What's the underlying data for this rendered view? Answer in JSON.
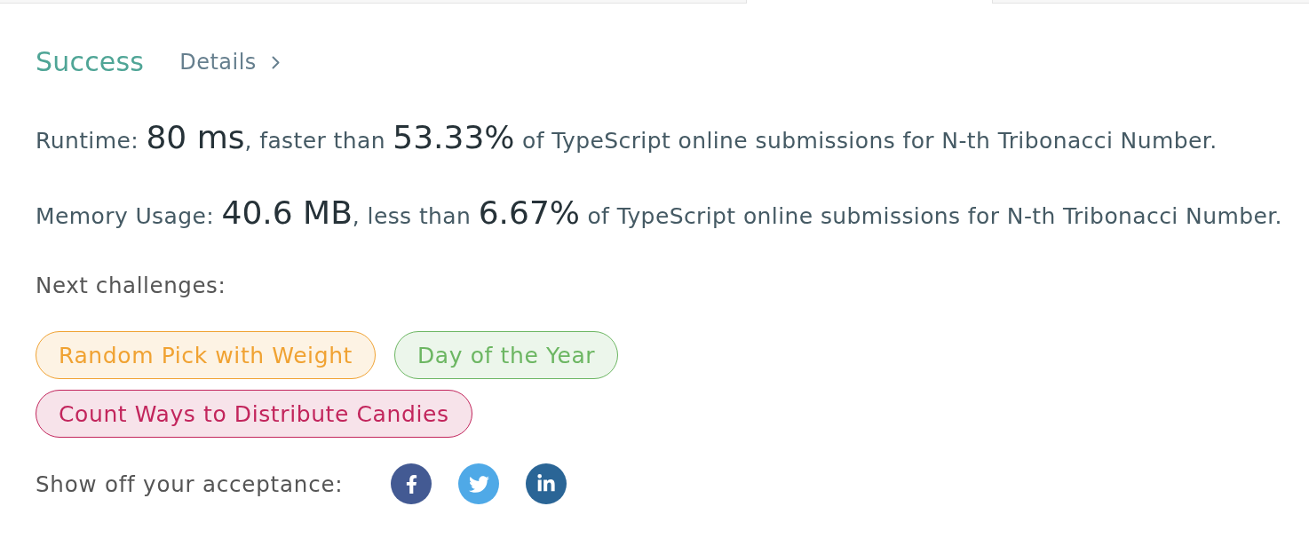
{
  "result": {
    "status": "Success",
    "details_link": "Details"
  },
  "stats": [
    {
      "label": "Runtime:",
      "value": "80 ms",
      "comparison": ", faster than",
      "percent": "53.33%",
      "suffix": "of TypeScript online submissions for N-th Tribonacci Number."
    },
    {
      "label": "Memory Usage:",
      "value": "40.6 MB",
      "comparison": ", less than",
      "percent": "6.67%",
      "suffix": "of TypeScript online submissions for N-th Tribonacci Number."
    }
  ],
  "next_challenges": {
    "label": "Next challenges:",
    "items": [
      {
        "title": "Random Pick with Weight",
        "color": "#f0a232"
      },
      {
        "title": "Day of the Year",
        "color": "#6cb662"
      },
      {
        "title": "Count Ways to Distribute Candies",
        "color": "#c2255c"
      }
    ]
  },
  "share": {
    "label": "Show off your acceptance:",
    "networks": [
      {
        "kind": "facebook"
      },
      {
        "kind": "twitter"
      },
      {
        "kind": "linkedin"
      }
    ]
  }
}
